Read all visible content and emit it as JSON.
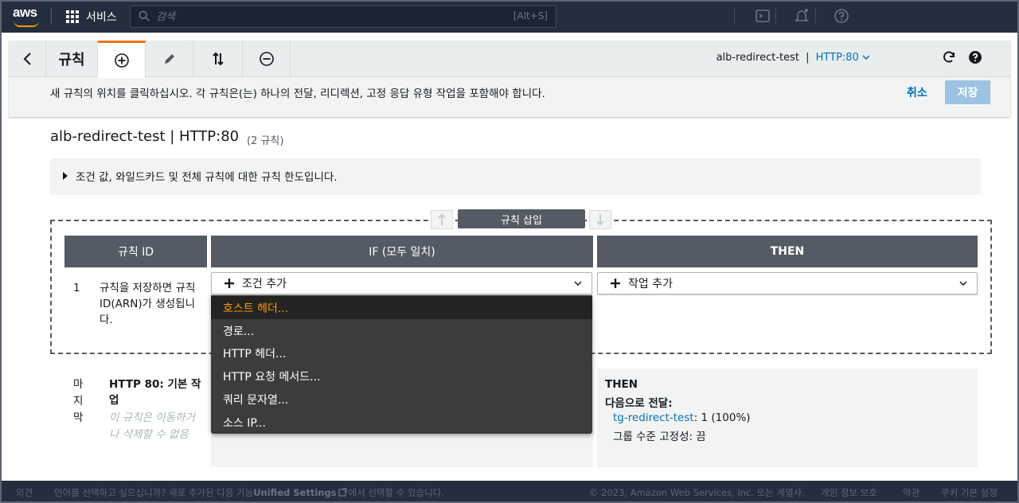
{
  "topnav": {
    "logo_text": "aws",
    "services_label": "서비스",
    "search_placeholder": "검색",
    "search_shortcut": "[Alt+S]"
  },
  "toolbar": {
    "title": "규칙",
    "listener_name": "alb-redirect-test",
    "listener_sep": "|",
    "listener_protocol": "HTTP:80",
    "instruction": "새 규칙의 위치를 클릭하십시오. 각 규칙은(는) 하나의 전달, 리디렉션, 고정 응답 유형 작업을 포함해야 합니다.",
    "cancel_label": "취소",
    "save_label": "저장"
  },
  "heading": {
    "title": "alb-redirect-test | HTTP:80",
    "rule_count": "(2 규칙)"
  },
  "limits": {
    "text": "조건 값, 와일드카드 및 전체 규칙에 대한 규칙 한도입니다."
  },
  "insert": {
    "badge": "규칙 삽입"
  },
  "columns": {
    "rule_id": "규칙 ID",
    "if": "IF (모두 일치)",
    "then": "THEN"
  },
  "new_rule": {
    "number": "1",
    "id_note": "규칙을 저장하면 규칙 ID(ARN)가 생성됩니다.",
    "add_condition": "조건 추가",
    "add_action": "작업 추가"
  },
  "dropdown": {
    "items": [
      "호스트 헤더...",
      "경로...",
      "HTTP 헤더...",
      "HTTP 요청 메서드...",
      "쿼리 문자열...",
      "소스 IP..."
    ]
  },
  "default_rule": {
    "label": "마지막",
    "title": "HTTP 80: 기본 작업",
    "note": "이 규칙은 이동하거나 삭제할 수 없음",
    "then_title": "THEN",
    "forward_label": "다음으로 전달:",
    "target_group": "tg-redirect-test",
    "target_weight": ": 1 (100%)",
    "stickiness": "그룹 수준 고정성: 끔"
  },
  "footer": {
    "feedback": "의견",
    "notice_pre": "언어를 선택하고 싶으십니까? 새로 추가된 다음 기능",
    "notice_link": "Unified Settings",
    "notice_post": "에서 선택할 수 있습니다.",
    "copyright": "© 2023, Amazon Web Services, Inc. 또는 계열사.",
    "privacy": "개인 정보 보호",
    "terms": "약관",
    "cookies": "쿠키 기본 설정"
  },
  "colors": {
    "nav_bg": "#232f3e",
    "accent_orange": "#ec7211",
    "link_blue": "#0073bb",
    "header_gray": "#545b64"
  }
}
